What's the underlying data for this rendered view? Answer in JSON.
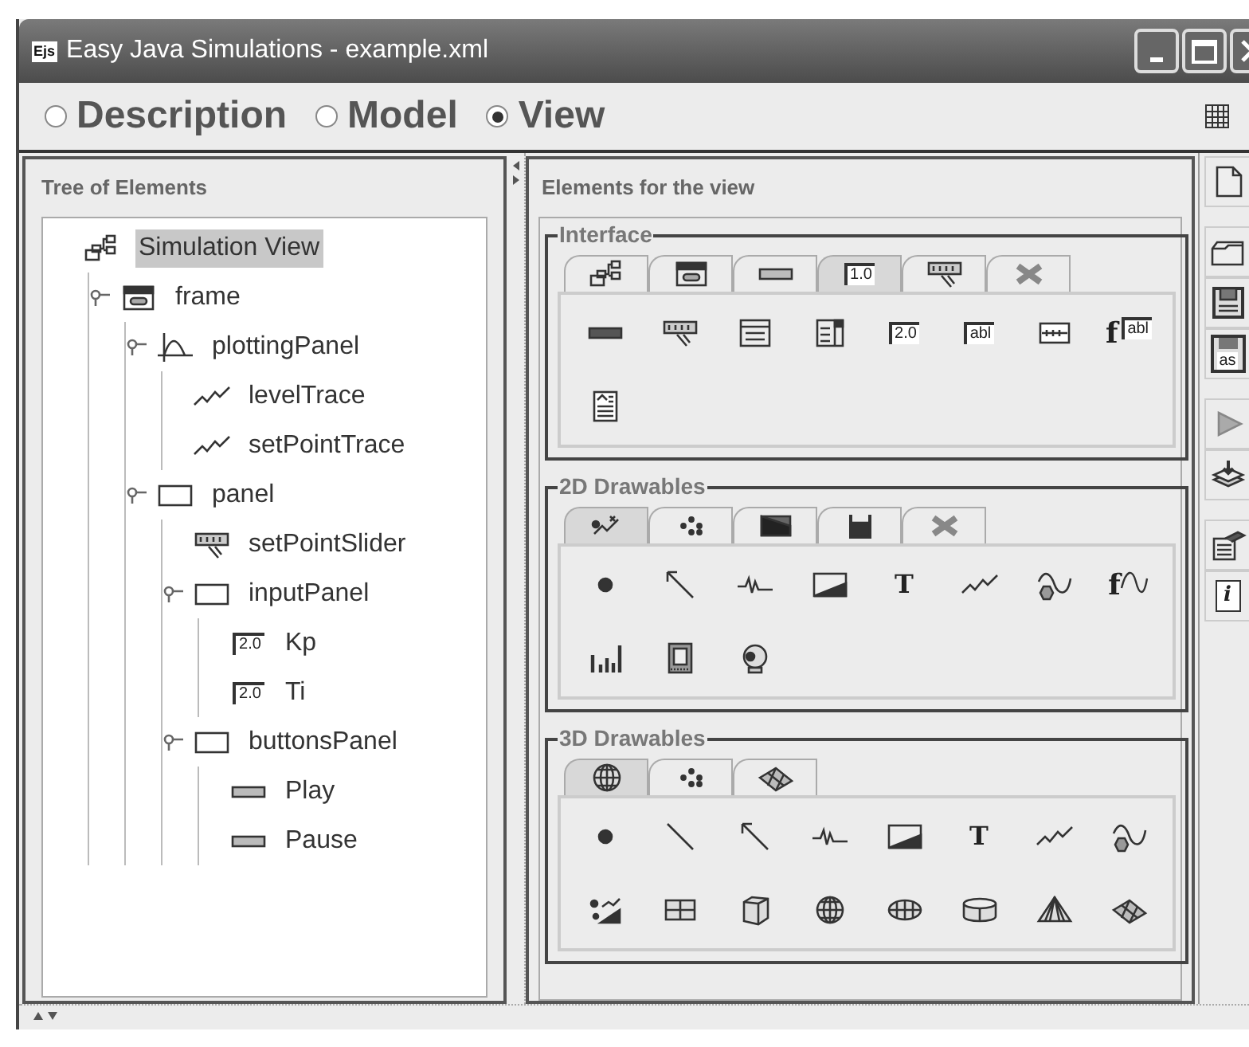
{
  "window": {
    "title": "Easy Java Simulations - example.xml",
    "logo_text": "Ejs"
  },
  "modes": [
    {
      "label": "Description",
      "selected": false
    },
    {
      "label": "Model",
      "selected": false
    },
    {
      "label": "View",
      "selected": true
    }
  ],
  "tree_panel": {
    "title": "Tree of Elements",
    "tree": [
      {
        "label": "Simulation View",
        "kind": "hierarchy",
        "selected": true,
        "expanded": true,
        "children": [
          {
            "label": "frame",
            "kind": "window",
            "selected": false,
            "expanded": true,
            "children": [
              {
                "label": "plottingPanel",
                "kind": "plot",
                "selected": false,
                "expanded": true,
                "children": [
                  {
                    "label": "levelTrace",
                    "kind": "trace",
                    "selected": false
                  },
                  {
                    "label": "setPointTrace",
                    "kind": "trace",
                    "selected": false
                  }
                ]
              },
              {
                "label": "panel",
                "kind": "panel",
                "selected": false,
                "expanded": true,
                "children": [
                  {
                    "label": "setPointSlider",
                    "kind": "slider",
                    "selected": false
                  },
                  {
                    "label": "inputPanel",
                    "kind": "panel",
                    "selected": false,
                    "expanded": true,
                    "children": [
                      {
                        "label": "Kp",
                        "kind": "number",
                        "icon_text": "2.0",
                        "selected": false
                      },
                      {
                        "label": "Ti",
                        "kind": "number",
                        "icon_text": "2.0",
                        "selected": false
                      }
                    ]
                  },
                  {
                    "label": "buttonsPanel",
                    "kind": "panel",
                    "selected": false,
                    "expanded": true,
                    "children": [
                      {
                        "label": "Play",
                        "kind": "button",
                        "selected": false
                      },
                      {
                        "label": "Pause",
                        "kind": "button",
                        "selected": false
                      }
                    ]
                  }
                ]
              }
            ]
          }
        ]
      }
    ]
  },
  "palette": {
    "title": "Elements for the view",
    "groups": [
      {
        "title": "Interface",
        "tabs": [
          {
            "kind": "hierarchy",
            "selected": false
          },
          {
            "kind": "window",
            "selected": false
          },
          {
            "kind": "button",
            "selected": false
          },
          {
            "kind": "number",
            "text": "1.0",
            "selected": true
          },
          {
            "kind": "slider",
            "selected": false
          },
          {
            "kind": "cross",
            "selected": false
          }
        ],
        "items": [
          {
            "kind": "bar"
          },
          {
            "kind": "slider"
          },
          {
            "kind": "table"
          },
          {
            "kind": "list"
          },
          {
            "kind": "number",
            "text": "2.0"
          },
          {
            "kind": "field",
            "text": "abl"
          },
          {
            "kind": "password"
          },
          {
            "kind": "formula",
            "text": "f",
            "text2": "abl"
          },
          {
            "kind": "textarea"
          }
        ]
      },
      {
        "title": "2D Drawables",
        "tabs": [
          {
            "kind": "shapes",
            "selected": true
          },
          {
            "kind": "particles",
            "selected": false
          },
          {
            "kind": "gradient",
            "selected": false
          },
          {
            "kind": "container",
            "selected": false
          },
          {
            "kind": "cross",
            "selected": false
          }
        ],
        "items": [
          {
            "kind": "dot"
          },
          {
            "kind": "arrow"
          },
          {
            "kind": "spring"
          },
          {
            "kind": "image"
          },
          {
            "kind": "letter",
            "text": "T"
          },
          {
            "kind": "trace"
          },
          {
            "kind": "curve"
          },
          {
            "kind": "function",
            "text": "f"
          },
          {
            "kind": "histogram"
          },
          {
            "kind": "film"
          },
          {
            "kind": "camera"
          }
        ]
      },
      {
        "title": "3D Drawables",
        "tabs": [
          {
            "kind": "globe",
            "selected": true
          },
          {
            "kind": "particles",
            "selected": false
          },
          {
            "kind": "surface",
            "selected": false
          }
        ],
        "items": [
          {
            "kind": "dot"
          },
          {
            "kind": "segment"
          },
          {
            "kind": "arrow"
          },
          {
            "kind": "spring"
          },
          {
            "kind": "image"
          },
          {
            "kind": "letter",
            "text": "T"
          },
          {
            "kind": "trace"
          },
          {
            "kind": "curve"
          },
          {
            "kind": "scatter"
          },
          {
            "kind": "grid"
          },
          {
            "kind": "cube"
          },
          {
            "kind": "globe"
          },
          {
            "kind": "disk"
          },
          {
            "kind": "cylinder"
          },
          {
            "kind": "cone"
          },
          {
            "kind": "surface"
          }
        ]
      }
    ]
  },
  "toolbar_groups": [
    [
      {
        "kind": "page"
      }
    ],
    [
      {
        "kind": "folder"
      },
      {
        "kind": "disk-save"
      },
      {
        "kind": "disk-save",
        "text": "as"
      }
    ],
    [
      {
        "kind": "play"
      },
      {
        "kind": "stack"
      }
    ],
    [
      {
        "kind": "editor"
      },
      {
        "kind": "info",
        "text": "i"
      }
    ]
  ]
}
